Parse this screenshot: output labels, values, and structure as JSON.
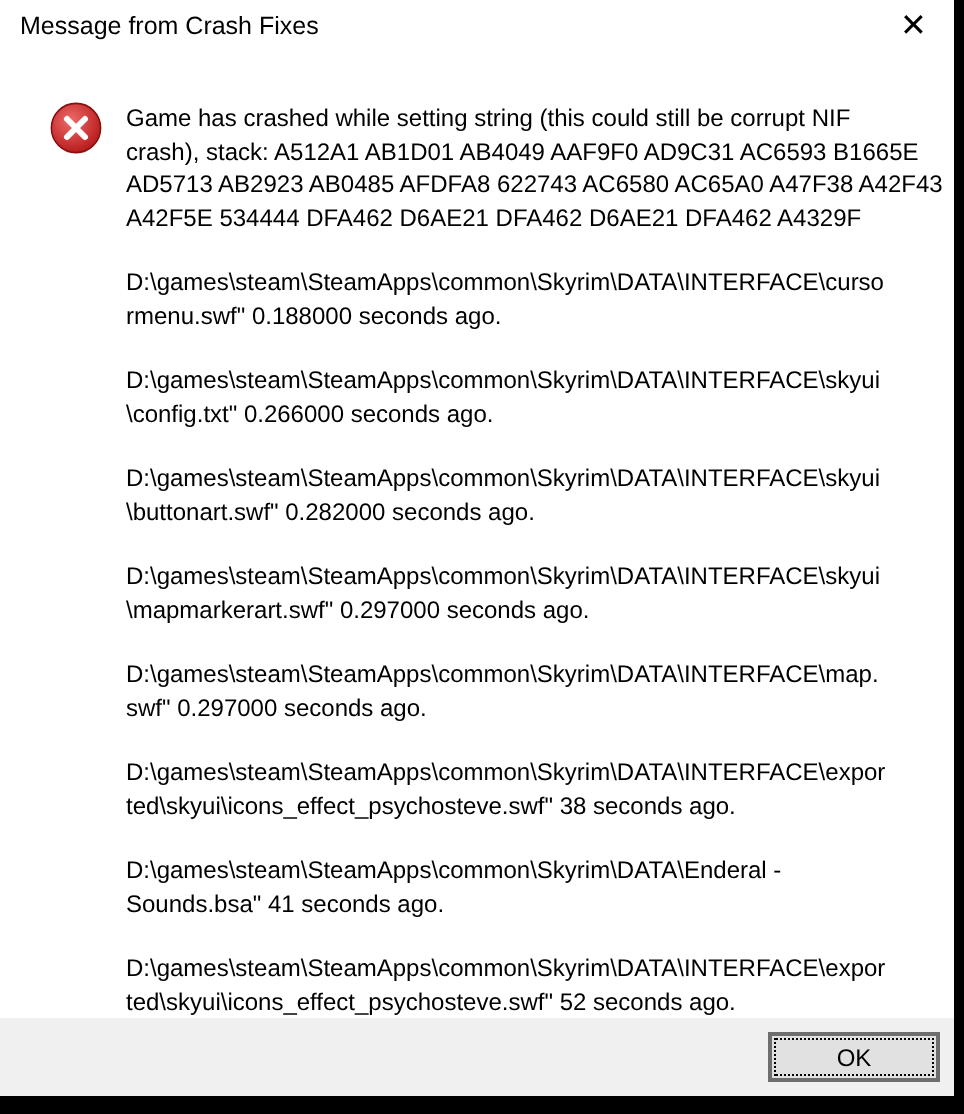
{
  "window": {
    "title": "Message from Crash Fixes",
    "close": "✕"
  },
  "message": [
    {
      "lines": [
        "Game has crashed while setting string (this could still be corrupt NIF",
        "crash), stack: A512A1 AB1D01 AB4049 AAF9F0 AD9C31 AC6593 B1665E",
        "AD5713 AB2923 AB0485 AFDFA8 622743 AC6580 AC65A0 A47F38 A42F43",
        "A42F5E 534444 DFA462 D6AE21 DFA462 D6AE21 DFA462 A4329F"
      ]
    },
    {
      "lines": [
        "D:\\games\\steam\\SteamApps\\common\\Skyrim\\DATA\\INTERFACE\\curso",
        "rmenu.swf\" 0.188000 seconds ago."
      ]
    },
    {
      "lines": [
        "D:\\games\\steam\\SteamApps\\common\\Skyrim\\DATA\\INTERFACE\\skyui",
        "\\config.txt\" 0.266000 seconds ago."
      ]
    },
    {
      "lines": [
        "D:\\games\\steam\\SteamApps\\common\\Skyrim\\DATA\\INTERFACE\\skyui",
        "\\buttonart.swf\" 0.282000 seconds ago."
      ]
    },
    {
      "lines": [
        "D:\\games\\steam\\SteamApps\\common\\Skyrim\\DATA\\INTERFACE\\skyui",
        "\\mapmarkerart.swf\" 0.297000 seconds ago."
      ]
    },
    {
      "lines": [
        "D:\\games\\steam\\SteamApps\\common\\Skyrim\\DATA\\INTERFACE\\map.",
        "swf\" 0.297000 seconds ago."
      ]
    },
    {
      "lines": [
        "D:\\games\\steam\\SteamApps\\common\\Skyrim\\DATA\\INTERFACE\\expor",
        "ted\\skyui\\icons_effect_psychosteve.swf\" 38 seconds ago."
      ]
    },
    {
      "lines": [
        "D:\\games\\steam\\SteamApps\\common\\Skyrim\\DATA\\Enderal -",
        "Sounds.bsa\" 41 seconds ago."
      ]
    },
    {
      "lines": [
        "D:\\games\\steam\\SteamApps\\common\\Skyrim\\DATA\\INTERFACE\\expor",
        "ted\\skyui\\icons_effect_psychosteve.swf\" 52 seconds ago."
      ]
    }
  ],
  "buttons": [
    {
      "label": "OK",
      "focused": true
    }
  ]
}
